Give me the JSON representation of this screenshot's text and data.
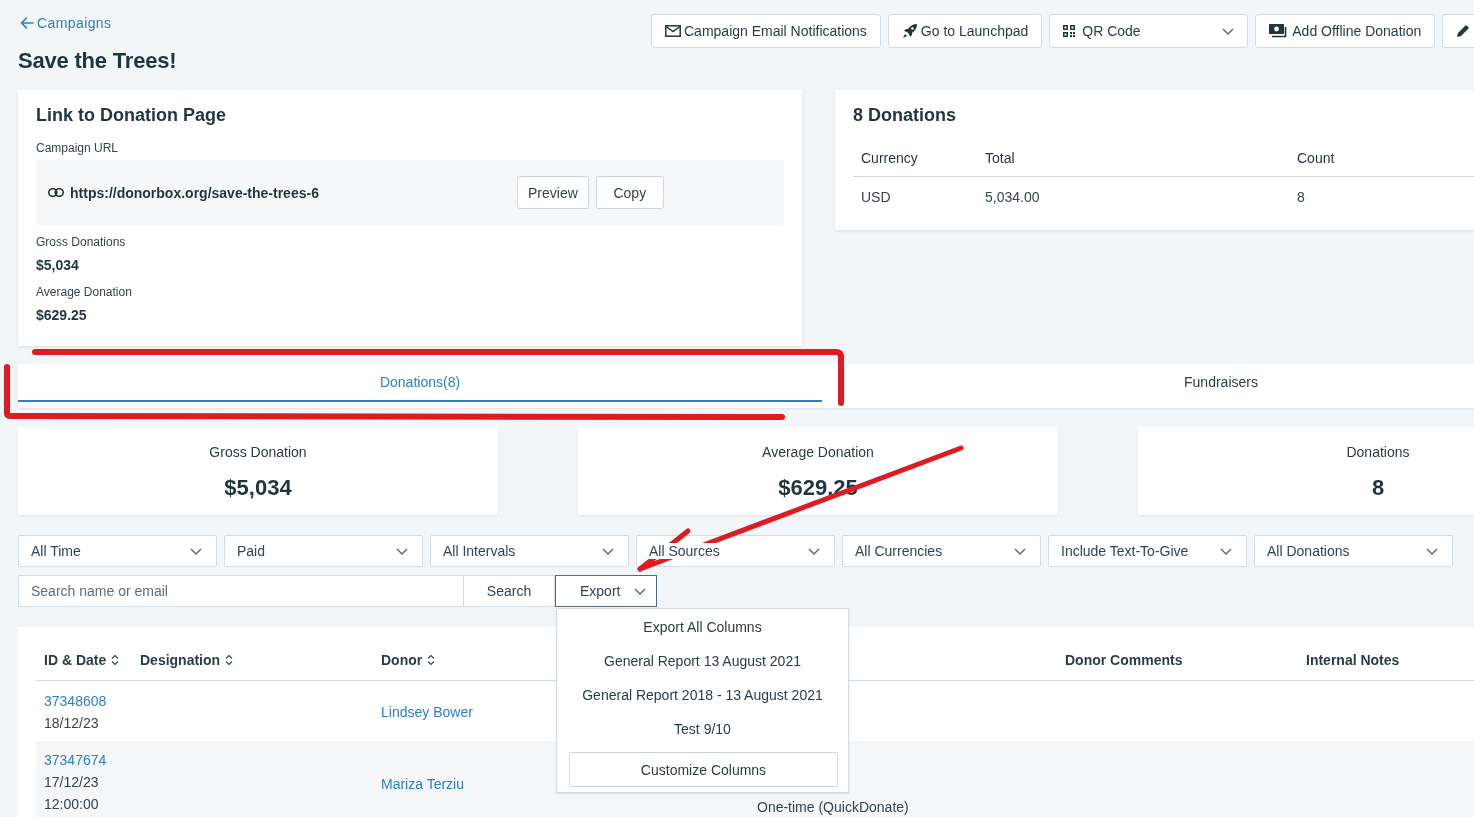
{
  "back_link": {
    "label": "Campaigns"
  },
  "title": "Save the Trees!",
  "toolbar": [
    {
      "kind": "button",
      "label": "Campaign Email Notifications"
    },
    {
      "kind": "button",
      "label": "Go to Launchpad"
    },
    {
      "kind": "dropdown",
      "label": "QR Code"
    },
    {
      "kind": "button",
      "label": "Add Offline Donation"
    },
    {
      "kind": "icon-button"
    }
  ],
  "link_card": {
    "title": "Link to Donation Page",
    "url_label": "Campaign URL",
    "url": "https://donorbox.org/save-the-trees-6",
    "buttons": [
      "Preview",
      "Copy"
    ],
    "stats": [
      {
        "label": "Gross Donations",
        "value": "$5,034"
      },
      {
        "label": "Average Donation",
        "value": "$629.25"
      }
    ]
  },
  "summary_card": {
    "title": "8 Donations",
    "columns": [
      "Currency",
      "Total",
      "Count"
    ],
    "rows": [
      [
        "USD",
        "5,034.00",
        "8"
      ]
    ]
  },
  "tabs": [
    {
      "label": "Donations(8)",
      "selected": true
    },
    {
      "label": "Fundraisers",
      "selected": false
    }
  ],
  "stat_cards": [
    {
      "label": "Gross Donation",
      "value": "$5,034"
    },
    {
      "label": "Average Donation",
      "value": "$629.25"
    },
    {
      "label": "Donations",
      "value": "8"
    }
  ],
  "filters": [
    "All Time",
    "Paid",
    "All Intervals",
    "All Sources",
    "All Currencies",
    "Include Text-To-Give",
    "All Donations"
  ],
  "search": {
    "placeholder": "Search name or email",
    "button": "Search"
  },
  "export": {
    "label": "Export",
    "expanded": true,
    "menu": [
      "Export All Columns",
      "General Report 13 August 2021",
      "General Report 2018 - 13 August 2021",
      "Test 9/10"
    ],
    "menu_button": "Customize Columns"
  },
  "table": {
    "columns": [
      {
        "label": "ID & Date",
        "sortable": true
      },
      {
        "label": "Designation",
        "sortable": true
      },
      {
        "label": "Donor",
        "sortable": true
      },
      {
        "label": "Donor Comments",
        "sortable": false
      },
      {
        "label": "Internal Notes",
        "sortable": false
      }
    ],
    "rows": [
      {
        "id": "37348608",
        "date_lines": [
          "18/12/23"
        ],
        "donor": "Lindsey Bower"
      },
      {
        "id": "37347674",
        "date_lines": [
          "17/12/23",
          "12:00:00"
        ],
        "donor": "Mariza Terziu",
        "column_4": "One-time (QuickDonate)"
      }
    ]
  }
}
